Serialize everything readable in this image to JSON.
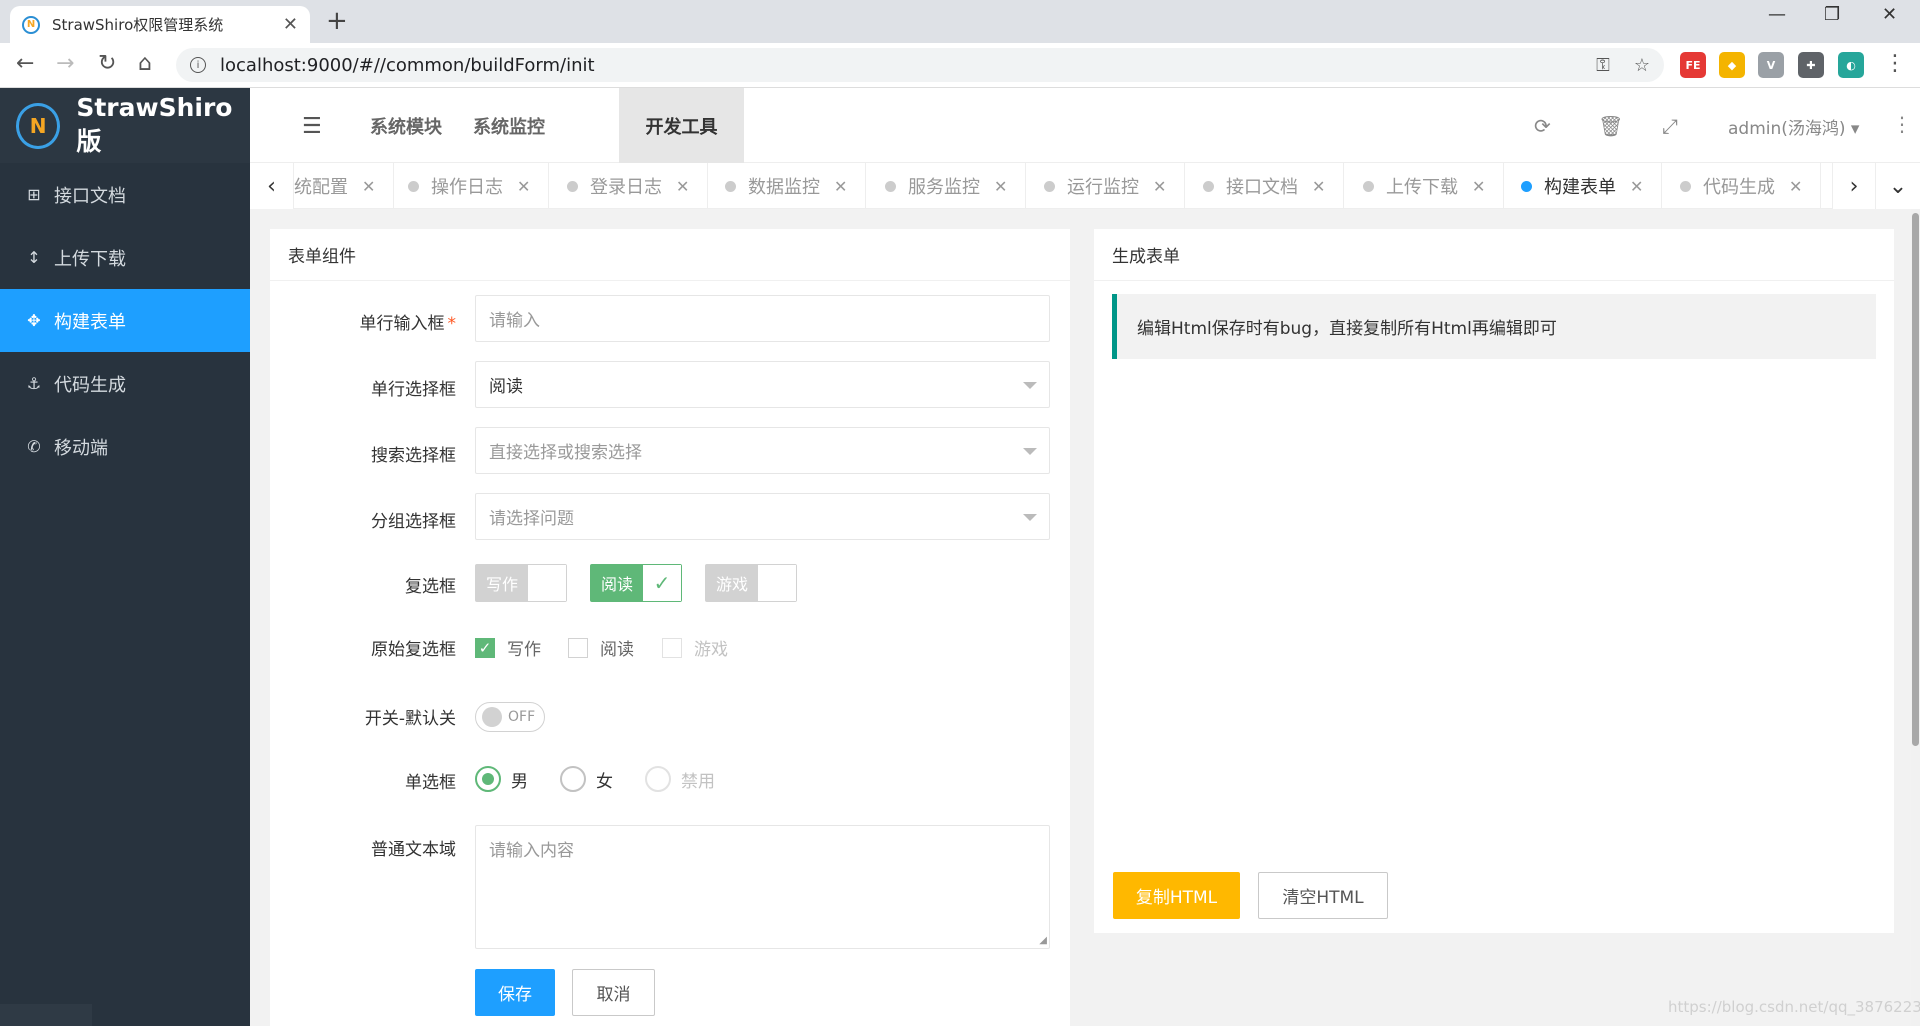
{
  "browser": {
    "tab_title": "StrawShiro权限管理系统",
    "favicon_text": "N",
    "url": "localhost:9000/#//common/buildForm/init",
    "extensions": [
      {
        "label": "FE",
        "color": "#e53935"
      },
      {
        "label": "◆",
        "color": "#f4b400"
      },
      {
        "label": "V",
        "color": "#9aa0a6"
      },
      {
        "label": "✚",
        "color": "#5f6368"
      },
      {
        "label": "◐",
        "color": "#26a69a"
      },
      {
        "label": "⬆",
        "color": "#e53935"
      }
    ]
  },
  "sidebar": {
    "logo_mark": "N",
    "brand": "StrawShiro版",
    "items": [
      {
        "icon": "sitemap-icon",
        "glyph": "⊞",
        "label": "接口文档"
      },
      {
        "icon": "updown-arrow-icon",
        "glyph": "↕",
        "label": "上传下载"
      },
      {
        "icon": "move-icon",
        "glyph": "✥",
        "label": "构建表单",
        "active": true
      },
      {
        "icon": "anchor-icon",
        "glyph": "⚓",
        "label": "代码生成"
      },
      {
        "icon": "phone-icon",
        "glyph": "✆",
        "label": "移动端"
      }
    ]
  },
  "header": {
    "tabs": [
      "系统模块",
      "系统监控",
      "开发工具"
    ],
    "active_tab": "开发工具",
    "user": "admin(汤海鸿)"
  },
  "page_tabs": [
    {
      "label": "统配置"
    },
    {
      "label": "操作日志"
    },
    {
      "label": "登录日志"
    },
    {
      "label": "数据监控"
    },
    {
      "label": "服务监控"
    },
    {
      "label": "运行监控"
    },
    {
      "label": "接口文档"
    },
    {
      "label": "上传下载"
    },
    {
      "label": "构建表单",
      "active": true
    },
    {
      "label": "代码生成"
    }
  ],
  "form_card": {
    "title": "表单组件",
    "input": {
      "label": "单行输入框",
      "placeholder": "请输入"
    },
    "select": {
      "label": "单行选择框",
      "value": "阅读"
    },
    "search_select": {
      "label": "搜索选择框",
      "placeholder": "直接选择或搜索选择"
    },
    "group_select": {
      "label": "分组选择框",
      "placeholder": "请选择问题"
    },
    "checkbox": {
      "label": "复选框",
      "options": [
        "写作",
        "阅读",
        "游戏"
      ],
      "checked": [
        "阅读"
      ]
    },
    "primary_checkbox": {
      "label": "原始复选框",
      "options": [
        "写作",
        "阅读",
        "游戏"
      ],
      "checked": [
        "写作"
      ],
      "disabled": [
        "游戏"
      ]
    },
    "switch": {
      "label": "开关-默认关",
      "text": "OFF",
      "on": false
    },
    "radio": {
      "label": "单选框",
      "options": [
        "男",
        "女",
        "禁用"
      ],
      "selected": "男",
      "disabled": [
        "禁用"
      ]
    },
    "textarea": {
      "label": "普通文本域",
      "placeholder": "请输入内容"
    },
    "save": "保存",
    "cancel": "取消"
  },
  "gen_card": {
    "title": "生成表单",
    "note": "编辑Html保存时有bug，直接复制所有Html再编辑即可",
    "copy": "复制HTML",
    "clear": "清空HTML"
  },
  "watermark": "https://blog.csdn.net/qq_3876223"
}
